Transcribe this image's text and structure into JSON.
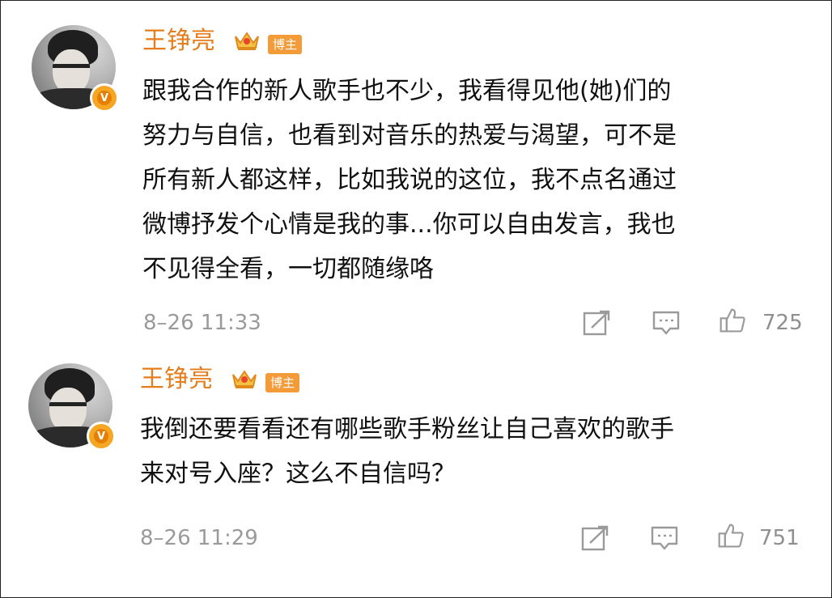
{
  "comments": [
    {
      "username": "王铮亮",
      "role_badge": "博主",
      "verified_mark": "V",
      "lines": [
        "跟我合作的新人歌手也不少，我看得见他(她)们的",
        "努力与自信，也看到对音乐的热爱与渴望，可不是",
        "所有新人都这样，比如我说的这位，我不点名通过",
        "微博抒发个心情是我的事...你可以自由发言，我也",
        "不见得全看，一切都随缘咯"
      ],
      "timestamp": "8–26 11:33",
      "likes": "725"
    },
    {
      "username": "王铮亮",
      "role_badge": "博主",
      "verified_mark": "V",
      "lines": [
        "我倒还要看看还有哪些歌手粉丝让自己喜欢的歌手",
        "来对号入座？这么不自信吗？"
      ],
      "timestamp": "8–26 11:29",
      "likes": "751"
    }
  ],
  "icons": {
    "crown": "crown-icon",
    "share": "share-icon",
    "comment": "comment-icon",
    "like": "thumbs-up-icon"
  },
  "colors": {
    "username": "#e47d1c",
    "badge": "#f29b38",
    "verified": "#f5a623",
    "meta": "#9a9a9a",
    "icon": "#9a9a9a"
  }
}
